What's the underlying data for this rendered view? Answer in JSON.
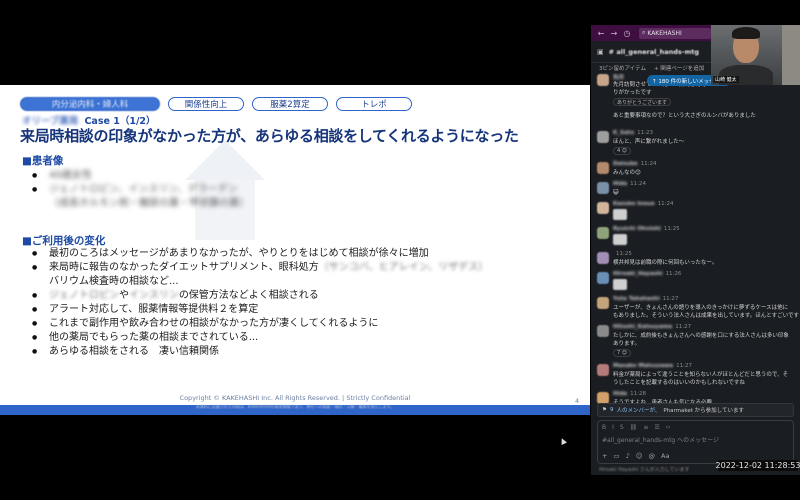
{
  "slide": {
    "tags": [
      {
        "label": "内分泌内科・婦人科",
        "active": true,
        "blurred": true
      },
      {
        "label": "関係性向上",
        "active": false
      },
      {
        "label": "服薬2算定",
        "active": false
      },
      {
        "label": "トレポ",
        "active": false
      }
    ],
    "case_prefix": "オリーブ薬局",
    "case_label": "Case 1（1/2）",
    "title": "来局時相談の印象がなかった方が、あらゆる相談をしてくれるようになった",
    "patient_heading": "■患者像",
    "patient_items": [
      {
        "text": "40歳女性",
        "blurred": true
      },
      {
        "text": "ジェノトロピン、インスリン、デラーデン",
        "blurred": true
      },
      {
        "text": "（成長ホルモン剤・糖尿の薬・甲状腺の薬）",
        "blurred": true,
        "no_bullet": true
      }
    ],
    "after_heading": "■ご利用後の変化",
    "after_items": [
      {
        "parts": [
          {
            "text": "最初のころはメッセージがあまりなかったが、やりとりをはじめて相談が徐々に増加"
          }
        ]
      },
      {
        "parts": [
          {
            "text": "来局時に報告のなかったダイエットサプリメント、眼科処方"
          },
          {
            "text": "（サンコバ、ヒアレイン、リザデス）",
            "blurred": true
          }
        ]
      },
      {
        "parts": [
          {
            "text": "バリウム検査時の相談など..."
          }
        ],
        "no_bullet": true
      },
      {
        "parts": [
          {
            "text": "ジェノトロピン",
            "blurred": true
          },
          {
            "text": "や"
          },
          {
            "text": "インスリン",
            "blurred": true
          },
          {
            "text": "の保管方法などよく相談される"
          }
        ]
      },
      {
        "parts": [
          {
            "text": "アラート対応して、服薬情報等提供料２を算定"
          }
        ]
      },
      {
        "parts": [
          {
            "text": "これまで副作用や飲み合わせの相談がなかった方が凄くしてくれるように"
          }
        ]
      },
      {
        "parts": [
          {
            "text": "他の薬局でもらった薬の相談までされている..."
          }
        ]
      },
      {
        "parts": [
          {
            "text": "あらゆる相談をされる　凄い信頼関係"
          }
        ]
      }
    ],
    "copyright": "Copyright © KAKEHASHI Inc. All Rights Reserved. | Strictly Confidential",
    "disclaimer": "本資料に記載された内容は、KAKEHASHIの秘密情報であり、弊社への相談・検討・公開・複製を禁止します。",
    "page_number": "4"
  },
  "slack": {
    "search_label": "KAKEHASHI",
    "channel": "# all_general_hands-mtg",
    "pins": [
      "3ピン留めアイテム",
      "+ 関連ページを追加"
    ],
    "new_messages_pill": "↑ 180 件の新しいメッセージ",
    "webcam_name": "山崎 健太",
    "messages": [
      {
        "name": "先月",
        "time": "",
        "lines": [
          "先月訪問させていただいた薬局さんで",
          "りがかったです"
        ],
        "reaction": "ありがとうございます",
        "avatar": "#c7a58a"
      },
      {
        "name": "",
        "time": "",
        "lines": [
          "あと重要事項なので？という大さぎのルンバがありました"
        ],
        "avatar": ""
      },
      {
        "name": "K_Sato",
        "time": "11:23",
        "lines": [
          "ほんと、声に繋がれました〜"
        ],
        "reaction": "4 😊",
        "avatar": "#9e9e9e"
      },
      {
        "name": "Daisuke",
        "time": "11:24",
        "lines": [
          "みんなの😊"
        ],
        "avatar": "#b58a6a"
      },
      {
        "name": "Hida",
        "time": "11:24",
        "lines": [
          "😺"
        ],
        "avatar": "#7a8fa8"
      },
      {
        "name": "Kazuko Inoue",
        "time": "11:24",
        "lines": [
          ""
        ],
        "sticker": true,
        "avatar": "#d2b49a"
      },
      {
        "name": "Ryuichi Ohnishi",
        "time": "11:25",
        "lines": [
          ""
        ],
        "sticker": true,
        "avatar": "#8fa37a"
      },
      {
        "name": "",
        "time": "11:25",
        "lines": [
          "横井邦見は前職の際に何回もいったなー。"
        ],
        "avatar": "#a38fb5"
      },
      {
        "name": "Hiroaki_Hayashi",
        "time": "11:26",
        "lines": [
          ""
        ],
        "sticker": true,
        "avatar": "#6a8fb5"
      },
      {
        "name": "Yuta Takahashi",
        "time": "11:27",
        "lines": [
          "ユーザーが、きょんさんの語りを導入のきっかけに夢ずるケースは他に",
          "もありました。そういう法人さんは成果を出しています。ほんとすごいです"
        ],
        "avatar": "#c4a47a"
      },
      {
        "name": "Hitoshi_Katsuyama",
        "time": "11:27",
        "lines": [
          "たしかに、成約後もきょんさんへの感謝を口にする法人さんは多い印象",
          "あります。"
        ],
        "reaction": "7 😊",
        "avatar": "#8a8a8a"
      },
      {
        "name": "Masako Matsuzawa",
        "time": "11:27",
        "lines": [
          "料金が薬局によって違うことを知らない人がほとんどだと思うので、そ",
          "うしたことを記載するのはいいのかもしれないですね"
        ],
        "avatar": "#b57a7a"
      },
      {
        "name": "Hida",
        "time": "11:28",
        "lines": [
          "そうですよね、患者さんも気になる必要"
        ],
        "avatar": "#d4a06a"
      }
    ],
    "members_prefix": "9",
    "members_text": "人のメンバーが、",
    "members_suffix": "Pharmaket から参加しています",
    "input_placeholder": "#all_general_hands-mtg へのメッセージ",
    "typing": "Hiroaki Hayashi さんが入力しています"
  },
  "timestamp": "2022-12-02  11:28:53"
}
